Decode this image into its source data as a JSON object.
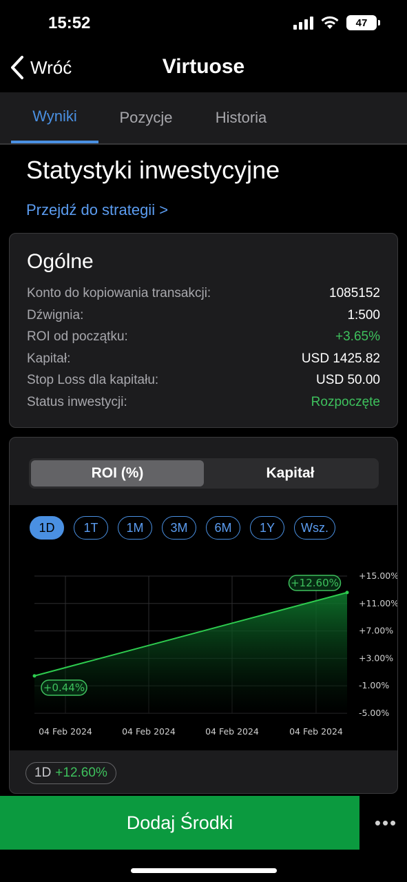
{
  "status_bar": {
    "time": "15:52",
    "battery": "47"
  },
  "nav": {
    "back_label": "Wróć",
    "title": "Virtuose"
  },
  "tabs": [
    {
      "label": "Wyniki",
      "active": true
    },
    {
      "label": "Pozycje",
      "active": false
    },
    {
      "label": "Historia",
      "active": false
    }
  ],
  "section_title": "Statystyki inwestycyjne",
  "strategy_link": "Przejdź do strategii >",
  "general": {
    "title": "Ogólne",
    "rows": [
      {
        "label": "Konto do kopiowania transakcji:",
        "value": "1085152"
      },
      {
        "label": "Dźwignia:",
        "value": "1:500"
      },
      {
        "label": "ROI od początku:",
        "value": "+3.65%"
      },
      {
        "label": "Kapitał:",
        "value": "USD 1425.82"
      },
      {
        "label": "Stop Loss dla kapitału:",
        "value": "USD 50.00"
      },
      {
        "label": "Status inwestycji:",
        "value": "Rozpoczęte"
      }
    ]
  },
  "segmented": {
    "roi_label": "ROI (%)",
    "capital_label": "Kapitał",
    "selected": "roi"
  },
  "periods": [
    "1D",
    "1T",
    "1M",
    "3M",
    "6M",
    "1Y",
    "Wsz."
  ],
  "active_period": "1D",
  "colors": {
    "accent": "#4a90e2",
    "positive": "#3ec15d",
    "button": "#0b9a3f"
  },
  "chart_data": {
    "type": "area",
    "x_ticks": [
      "04 Feb 2024",
      "04 Feb 2024",
      "04 Feb 2024",
      "04 Feb 2024"
    ],
    "y_ticks": [
      "+15.00%",
      "+11.00%",
      "+7.00%",
      "+3.00%",
      "-1.00%",
      "-5.00%"
    ],
    "ylim": [
      -5,
      15
    ],
    "series": [
      {
        "x": [
          0,
          1
        ],
        "values": [
          0.44,
          12.6
        ]
      }
    ],
    "start_label": "+0.44%",
    "end_label": "+12.60%",
    "grid": true
  },
  "footer": {
    "period": "1D",
    "value": "+12.60%"
  },
  "add_funds_label": "Dodaj Środki",
  "more_label": "•••"
}
